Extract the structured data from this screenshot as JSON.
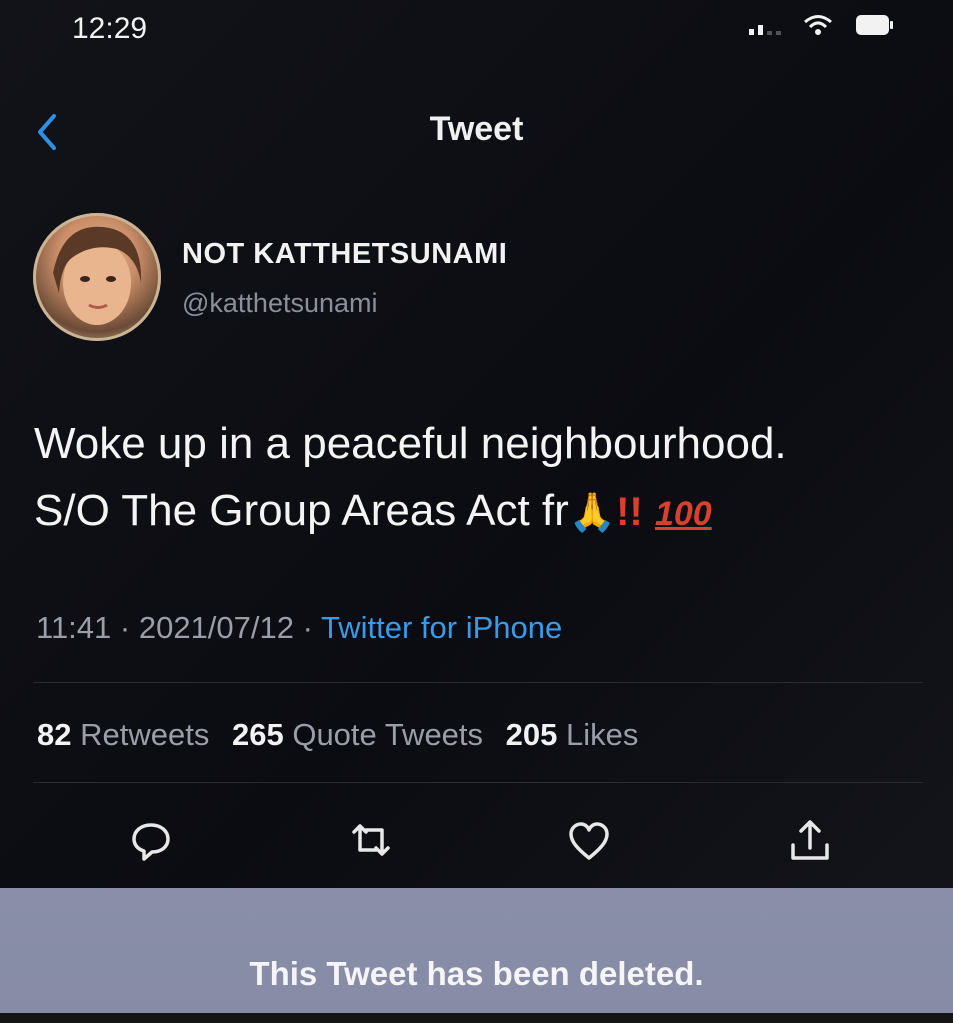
{
  "status_bar": {
    "time": "12:29"
  },
  "nav": {
    "title": "Tweet"
  },
  "tweet": {
    "author": {
      "display_name": "NOT KATTHETSUNAMI",
      "handle": "@katthetsunami"
    },
    "text_line1": "Woke up in a peaceful neighbourhood.",
    "text_line2": "S/O The Group Areas Act fr",
    "emoji": {
      "folded_hands": "🙏",
      "double_bang": "!!",
      "hundred": "100"
    },
    "time": "11:41",
    "date": "2021/07/12",
    "separator": " · ",
    "source": "Twitter for iPhone",
    "stats": {
      "retweets_count": "82",
      "retweets_label": "Retweets",
      "quotes_count": "265",
      "quotes_label": "Quote Tweets",
      "likes_count": "205",
      "likes_label": "Likes"
    }
  },
  "banner": {
    "text": "This Tweet has been deleted."
  },
  "icons": [
    "back-chevron-icon",
    "signal-icon",
    "wifi-icon",
    "battery-icon",
    "reply-icon",
    "retweet-icon",
    "like-icon",
    "share-icon"
  ],
  "colors": {
    "background": "#0c0d12",
    "link": "#3a9ae8",
    "banner": "#898da7",
    "emoji_red": "#d9412c"
  }
}
